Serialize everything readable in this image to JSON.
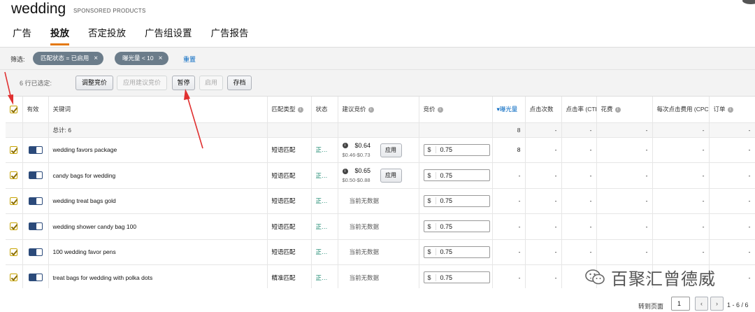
{
  "header": {
    "title": "wedding",
    "subtitle": "SPONSORED PRODUCTS",
    "tabs": [
      {
        "label": "广告",
        "active": false
      },
      {
        "label": "投放",
        "active": true
      },
      {
        "label": "否定投放",
        "active": false
      },
      {
        "label": "广告组设置",
        "active": false
      },
      {
        "label": "广告报告",
        "active": false
      }
    ]
  },
  "filters": {
    "label": "筛选:",
    "chips": [
      "匹配状态 = 已启用",
      "曝光量 < 10"
    ],
    "reset_label": "重置"
  },
  "actions": {
    "selection_text": "6 行已选定:",
    "buttons": [
      {
        "label": "调整竞价",
        "enabled": true
      },
      {
        "label": "应用建议竞价",
        "enabled": false
      },
      {
        "label": "暂停",
        "enabled": true
      },
      {
        "label": "启用",
        "enabled": false
      },
      {
        "label": "存档",
        "enabled": true
      }
    ]
  },
  "table": {
    "columns": [
      "有效",
      "关键词",
      "匹配类型",
      "状态",
      "建议竞价",
      "竞价",
      "曝光量",
      "点击次数",
      "点击率 (CTR)",
      "花费",
      "每次点击费用 (CPC)",
      "订单"
    ],
    "total_label": "总计: 6",
    "total_row": {
      "impressions": "8",
      "clicks": "-",
      "ctr": "-",
      "spend": "-",
      "cpc": "-",
      "orders": "-"
    },
    "apply_label": "应用",
    "no_data_label": "当前无数据",
    "rows": [
      {
        "keyword": "wedding favors package",
        "match": "短语匹配",
        "status": "正…",
        "suggested": "$0.64",
        "range": "$0.46-$0.73",
        "has_suggestion": true,
        "currency": "$",
        "bid": "0.75",
        "impressions": "8",
        "clicks": "-",
        "ctr": "-",
        "spend": "-",
        "cpc": "-",
        "orders": "-"
      },
      {
        "keyword": "candy bags for wedding",
        "match": "短语匹配",
        "status": "正…",
        "suggested": "$0.65",
        "range": "$0.50-$0.88",
        "has_suggestion": true,
        "currency": "$",
        "bid": "0.75",
        "impressions": "-",
        "clicks": "-",
        "ctr": "-",
        "spend": "-",
        "cpc": "-",
        "orders": "-"
      },
      {
        "keyword": "wedding treat bags gold",
        "match": "短语匹配",
        "status": "正…",
        "suggested": "",
        "range": "",
        "has_suggestion": false,
        "currency": "$",
        "bid": "0.75",
        "impressions": "-",
        "clicks": "-",
        "ctr": "-",
        "spend": "-",
        "cpc": "-",
        "orders": "-"
      },
      {
        "keyword": "wedding shower candy bag 100",
        "match": "短语匹配",
        "status": "正…",
        "suggested": "",
        "range": "",
        "has_suggestion": false,
        "currency": "$",
        "bid": "0.75",
        "impressions": "-",
        "clicks": "-",
        "ctr": "-",
        "spend": "-",
        "cpc": "-",
        "orders": "-"
      },
      {
        "keyword": "100 wedding favor pens",
        "match": "短语匹配",
        "status": "正…",
        "suggested": "",
        "range": "",
        "has_suggestion": false,
        "currency": "$",
        "bid": "0.75",
        "impressions": "-",
        "clicks": "-",
        "ctr": "-",
        "spend": "-",
        "cpc": "-",
        "orders": "-"
      },
      {
        "keyword": "treat bags for wedding with polka dots",
        "match": "精准匹配",
        "status": "正…",
        "suggested": "",
        "range": "",
        "has_suggestion": false,
        "currency": "$",
        "bid": "0.75",
        "impressions": "-",
        "clicks": "-",
        "ctr": "-",
        "spend": "-",
        "cpc": "-",
        "orders": "-"
      }
    ]
  },
  "pagination": {
    "goto_label": "转到页面",
    "page": "1",
    "prev": "‹",
    "next": "›",
    "range_text": "1 - 6 / 6"
  },
  "watermark": {
    "text": "百聚汇曾德威"
  },
  "colors": {
    "accent": "#e47911",
    "link": "#0066c0",
    "annotation": "#e03030",
    "chip": "#6b7c8a",
    "status": "#067d62"
  }
}
